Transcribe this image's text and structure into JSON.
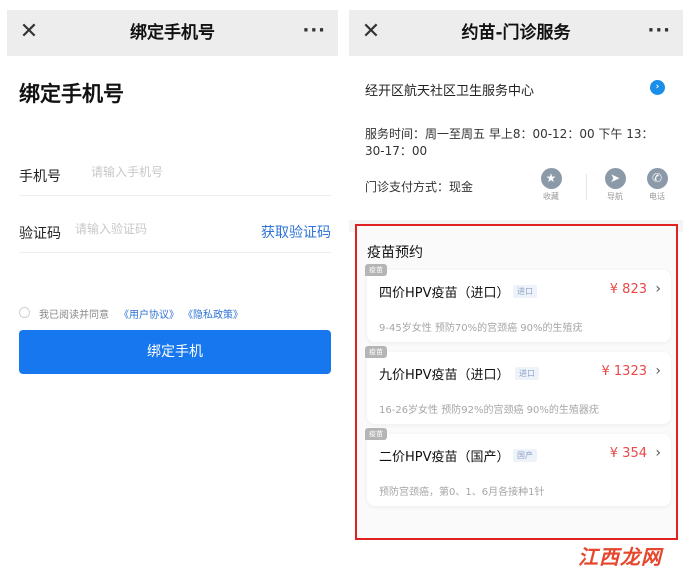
{
  "left": {
    "nav": {
      "close": "✕",
      "title": "绑定手机号",
      "more": "···"
    },
    "heading": "绑定手机号",
    "phone": {
      "label": "手机号",
      "placeholder": "请输入手机号"
    },
    "code": {
      "label": "验证码",
      "placeholder": "请输入验证码",
      "action": "获取验证码"
    },
    "agree": {
      "text": "我已阅读并同意",
      "link1": "《用户协议》",
      "link2": "《隐私政策》"
    },
    "submit": "绑定手机"
  },
  "right": {
    "nav": {
      "close": "✕",
      "title": "约苗-门诊服务",
      "more": "···"
    },
    "clinic_name": "经开区航天社区卫生服务中心",
    "service_time": "服务时间：周一至周五 早上8：00-12：00 下午 13：30-17：00",
    "payment": "门诊支付方式：现金",
    "actions": [
      {
        "icon": "star-icon",
        "label": "收藏"
      },
      {
        "icon": "navigation-icon",
        "label": "导航"
      },
      {
        "icon": "phone-icon",
        "label": "电话"
      }
    ],
    "vaccine_heading": "疫苗预约",
    "vaccines": [
      {
        "tag": "疫苗",
        "title": "四价HPV疫苗（进口）",
        "origin": "进口",
        "price": "¥ 823",
        "desc": "9-45岁女性 预防70%的宫颈癌 90%的生殖疣"
      },
      {
        "tag": "疫苗",
        "title": "九价HPV疫苗（进口）",
        "origin": "进口",
        "price": "¥ 1323",
        "desc": "16-26岁女性 预防92%的宫颈癌 90%的生殖器疣"
      },
      {
        "tag": "疫苗",
        "title": "二价HPV疫苗（国产）",
        "origin": "国产",
        "price": "¥ 354",
        "desc": "预防宫颈癌，第0、1、6月各接种1针"
      }
    ]
  },
  "watermark": "江西龙网",
  "colors": {
    "primary": "#1677ee",
    "link": "#2f73d6",
    "price": "#e94848",
    "highlight": "#e02121"
  }
}
